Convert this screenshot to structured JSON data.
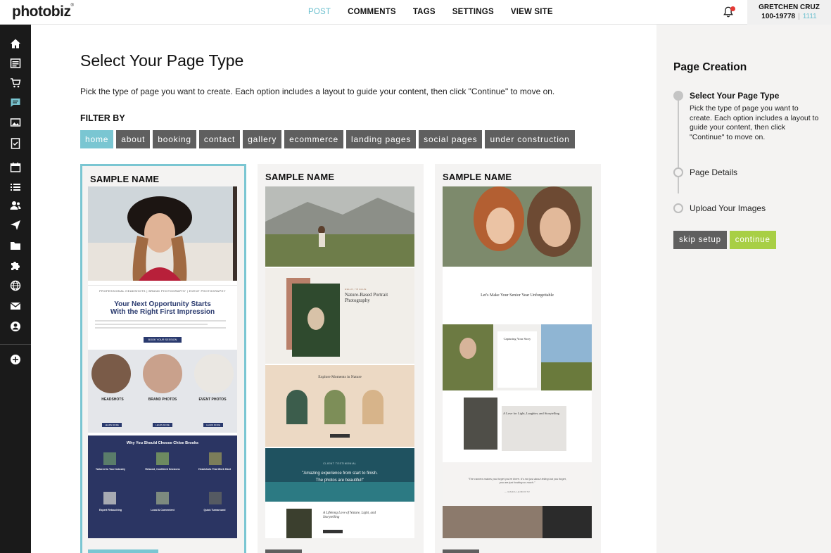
{
  "header": {
    "logo": "photobiz",
    "logo_mark": "®",
    "nav": [
      "POST",
      "COMMENTS",
      "TAGS",
      "SETTINGS",
      "VIEW SITE"
    ],
    "active_nav": "POST",
    "user_name": "GRETCHEN CRUZ",
    "account_id": "100-19778",
    "account_sep": "|",
    "account_num": "1111"
  },
  "sidebar_icons": [
    "home-icon",
    "layout-icon",
    "cart-icon",
    "comment-icon",
    "image-icon",
    "checklist-icon",
    "calendar-icon",
    "list-icon",
    "users-icon",
    "send-icon",
    "folder-icon",
    "puzzle-icon",
    "globe-icon",
    "mail-icon",
    "account-icon",
    "add-circle-icon"
  ],
  "main": {
    "title": "Select Your Page Type",
    "intro": "Pick the type of page you want to create. Each option includes a layout to guide your content, then click \"Continue\" to move on.",
    "filter_label": "FILTER BY",
    "filters": [
      "home",
      "about",
      "booking",
      "contact",
      "gallery",
      "ecommerce",
      "landing pages",
      "social pages",
      "under construction"
    ],
    "active_filter": "home",
    "cards": [
      {
        "name": "SAMPLE NAME",
        "tagline": "PROFESSIONAL HEADSHOTS | BRAND PHOTOGRAPHY | EVENT PHOTOGRAPHY",
        "headline1": "Your Next Opportunity Starts",
        "headline2": "With the Right First Impression",
        "cta": "BOOK YOUR SESSION",
        "cols": [
          "HEADSHOTS",
          "BRAND PHOTOS",
          "EVENT PHOTOS"
        ],
        "learn": "LEARN MORE",
        "why": "Why You Should Choose Chloe Brooks",
        "why_items": [
          "Tailored to Your Industry",
          "Relaxed, Confident Sessions",
          "Headshots That Work Hard",
          "Expert Retouching",
          "Local & Convenient",
          "Quick Turnaround"
        ]
      },
      {
        "name": "SAMPLE NAME",
        "kicker": "HELLO, I'M ELLIE",
        "heading": "Nature-Based Portrait Photography",
        "explore": "Explore Moments in Nature",
        "testimonial_label": "CLIENT TESTIMONIAL",
        "quote1": "\"Amazing experience from start to finish.",
        "quote2": "The photos are beautiful!\"",
        "footer_heading": "A Lifelong Love of Nature, Light, and Storytelling"
      },
      {
        "name": "SAMPLE NAME",
        "headline": "Let's Make Your Senior Year Unforgettable",
        "capturing": "Capturing Your Story",
        "love_heading": "A Love for Light, Laughter, and Storytelling",
        "quote": "\"The camera makes you forget you're there. It's not just about telling but you forget, you are just looking so much.\"",
        "quote_author": "— MARIA LEIBOVITZ"
      }
    ]
  },
  "panel": {
    "title": "Page Creation",
    "steps": [
      {
        "label": "Select Your Page Type",
        "desc": "Pick the type of page you want to create. Each option includes a layout to guide your content, then click \"Continue\" to move on."
      },
      {
        "label": "Page Details"
      },
      {
        "label": "Upload Your Images"
      }
    ],
    "skip_label": "skip setup",
    "continue_label": "continue"
  },
  "colors": {
    "accent": "#7ac6d2",
    "continue": "#a8cf45",
    "filter_bg": "#5f5f5f",
    "sidebar_bg": "#1a1a1a",
    "navy": "#2a3a6e"
  }
}
